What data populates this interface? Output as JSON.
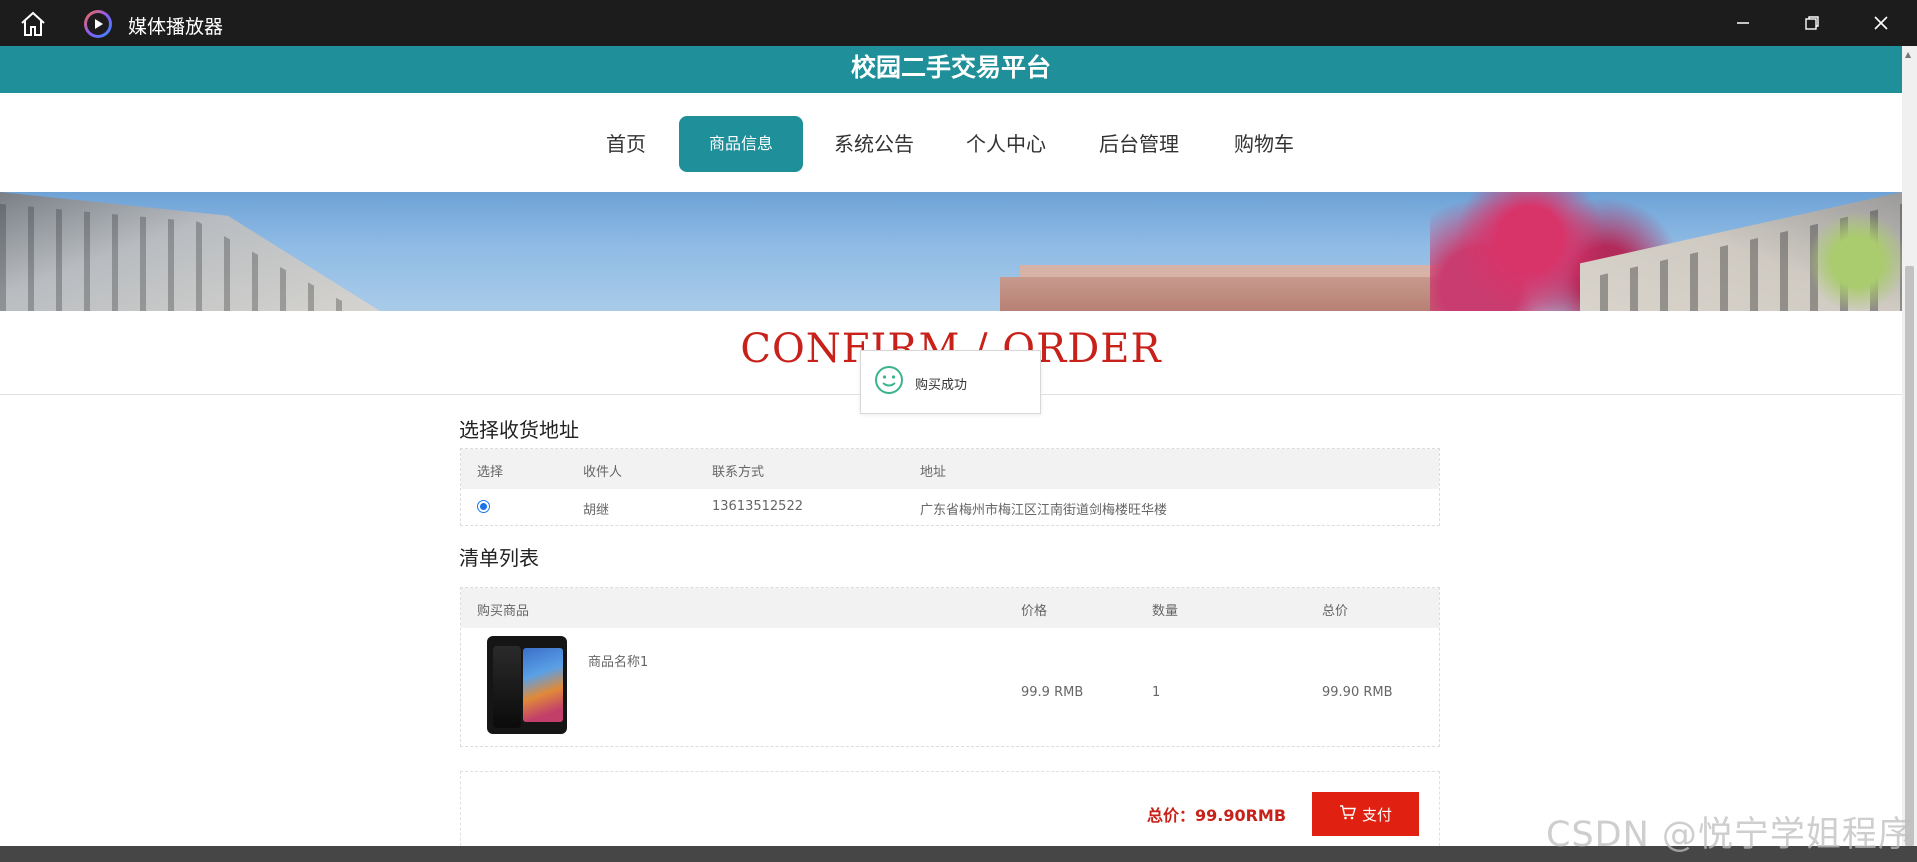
{
  "window": {
    "title": "媒体播放器",
    "icons": [
      "home-icon",
      "media-player-icon",
      "minimize-icon",
      "maximize-icon",
      "close-icon"
    ]
  },
  "site": {
    "title": "校园二手交易平台"
  },
  "nav": {
    "items": [
      {
        "label": "首页",
        "active": false
      },
      {
        "label": "商品信息",
        "active": true
      },
      {
        "label": "系统公告",
        "active": false
      },
      {
        "label": "个人中心",
        "active": false
      },
      {
        "label": "后台管理",
        "active": false
      },
      {
        "label": "购物车",
        "active": false
      }
    ]
  },
  "page": {
    "heading": "CONFIRM / ORDER"
  },
  "toast": {
    "message": "购买成功",
    "icon": "smile-icon"
  },
  "address": {
    "section_title": "选择收货地址",
    "columns": [
      "选择",
      "收件人",
      "联系方式",
      "地址"
    ],
    "rows": [
      {
        "selected": true,
        "recipient": "胡继",
        "phone": "13613512522",
        "address": "广东省梅州市梅江区江南街道剑梅楼旺华楼"
      }
    ]
  },
  "order": {
    "section_title": "清单列表",
    "columns": [
      "购买商品",
      "价格",
      "数量",
      "总价"
    ],
    "items": [
      {
        "name": "商品名称1",
        "price": "99.9 RMB",
        "quantity": "1",
        "total": "99.90 RMB",
        "image": "phone-image"
      }
    ],
    "total_label": "总价：99.90RMB",
    "pay_label": "支付",
    "pay_icon": "cart-icon"
  },
  "watermark": "CSDN @悦宁学姐程序",
  "colors": {
    "accent": "#1f8f99",
    "price_red": "#c8211a",
    "pay_button": "#e02010"
  }
}
